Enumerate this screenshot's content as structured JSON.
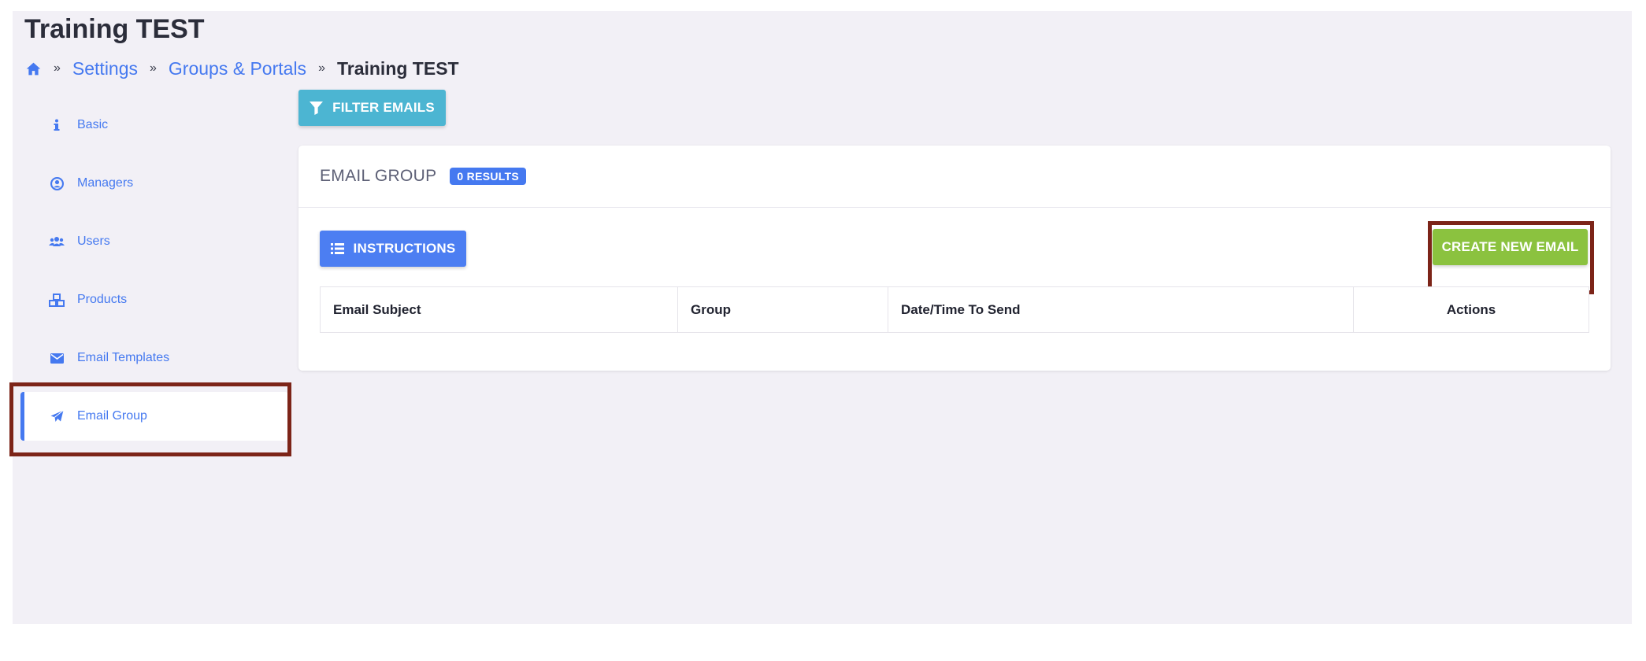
{
  "page": {
    "title": "Training TEST"
  },
  "breadcrumb": {
    "home_icon": "home-icon",
    "separator": "»",
    "items": [
      {
        "label": "Settings"
      },
      {
        "label": "Groups & Portals"
      },
      {
        "label": "Training TEST"
      }
    ]
  },
  "sidebar": {
    "items": [
      {
        "label": "Basic",
        "icon": "info-icon"
      },
      {
        "label": "Managers",
        "icon": "user-circle-icon"
      },
      {
        "label": "Users",
        "icon": "users-icon"
      },
      {
        "label": "Products",
        "icon": "cubes-icon"
      },
      {
        "label": "Email Templates",
        "icon": "envelope-icon"
      },
      {
        "label": "Email Group",
        "icon": "paper-plane-icon",
        "active": true
      }
    ]
  },
  "toolbar": {
    "filter_label": "FILTER EMAILS"
  },
  "card": {
    "title": "EMAIL GROUP",
    "results_badge": "0 RESULTS",
    "instructions_label": "INSTRUCTIONS",
    "create_label": "CREATE NEW EMAIL"
  },
  "table": {
    "columns": [
      "Email Subject",
      "Group",
      "Date/Time To Send",
      "Actions"
    ],
    "rows": []
  },
  "colors": {
    "accent": "#4579f0",
    "filter_button": "#4cb5d2",
    "create_button": "#8bc23f",
    "highlight_box": "#7c2418",
    "background": "#f2f0f6"
  }
}
